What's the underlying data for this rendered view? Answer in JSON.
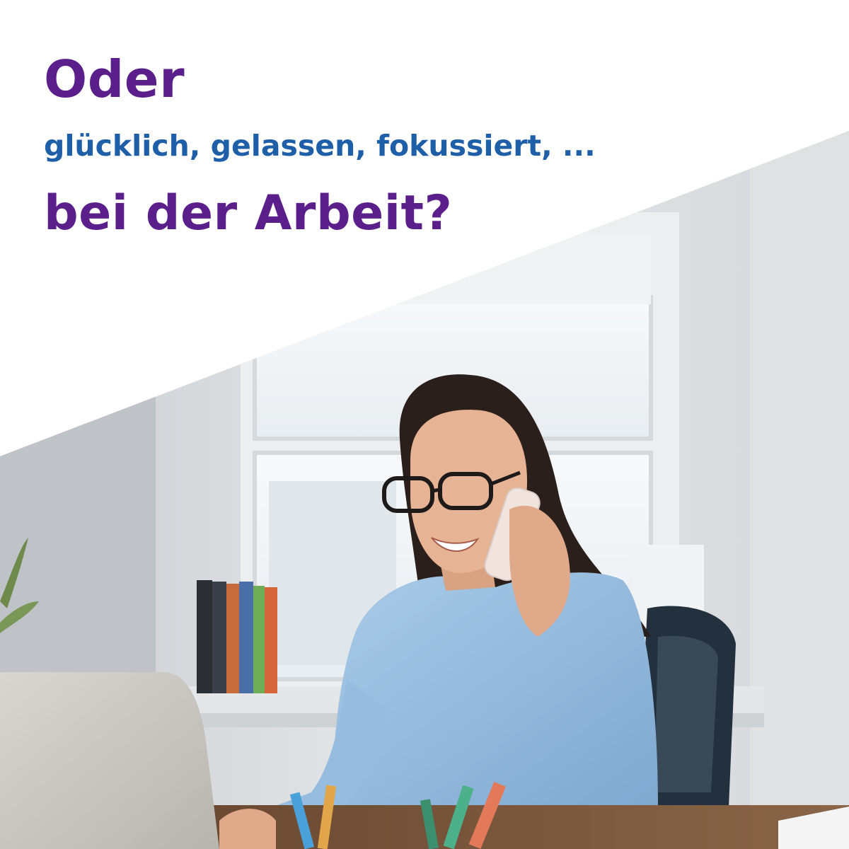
{
  "headline": {
    "line1": "Oder",
    "line2": "glücklich, gelassen, fokussiert, ...",
    "line3": "bei der Arbeit?"
  },
  "colors": {
    "primary_purple": "#5a1f8a",
    "secondary_blue": "#1e5fa8",
    "background": "#ffffff"
  },
  "photo": {
    "subject": "smiling-woman-on-phone-at-desk-with-laptop"
  }
}
